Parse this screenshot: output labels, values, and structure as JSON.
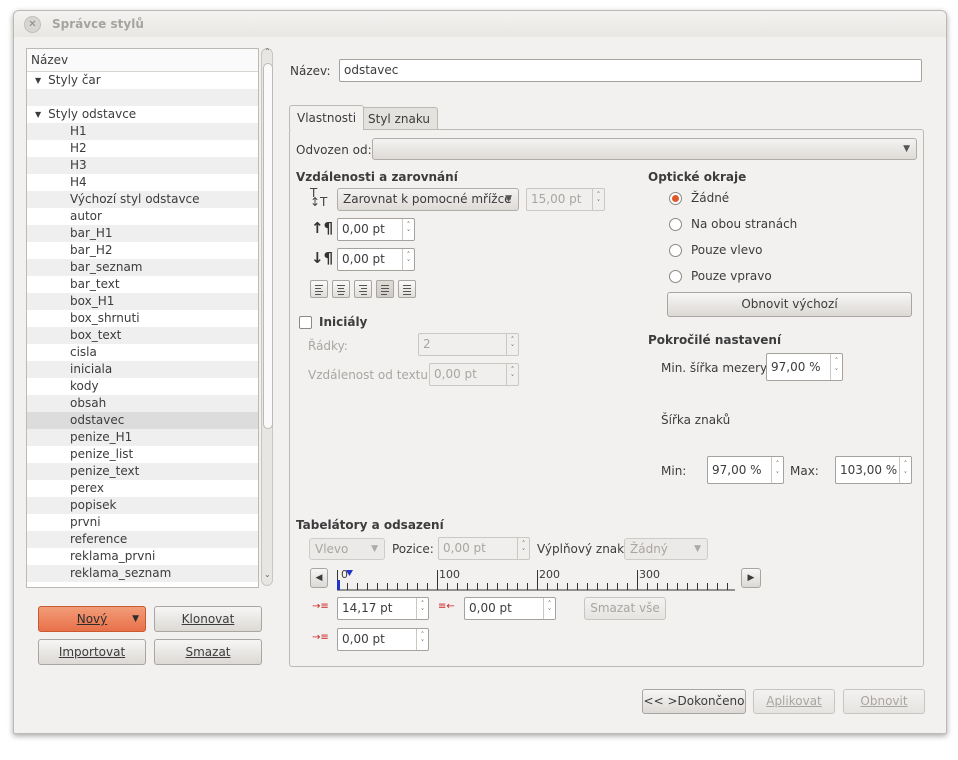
{
  "window": {
    "title": "Správce stylů"
  },
  "style_list": {
    "header": "Název",
    "groups": [
      {
        "label": "Styly čar",
        "items": []
      },
      {
        "label": "Styly odstavce",
        "items": [
          "H1",
          "H2",
          "H3",
          "H4",
          "Výchozí styl odstavce",
          "autor",
          "bar_H1",
          "bar_H2",
          "bar_seznam",
          "bar_text",
          "box_H1",
          "box_shrnuti",
          "box_text",
          "cisla",
          "iniciala",
          "kody",
          "obsah",
          "odstavec",
          "penize_H1",
          "penize_list",
          "penize_text",
          "perex",
          "popisek",
          "prvni",
          "reference",
          "reklama_prvni",
          "reklama_seznam"
        ]
      }
    ],
    "selected": "odstavec"
  },
  "left_buttons": {
    "new": "Nový",
    "clone": "Klonovat",
    "import": "Importovat",
    "delete": "Smazat"
  },
  "name_field": {
    "label": "Název:",
    "value": "odstavec"
  },
  "tabs": [
    "Vlastnosti",
    "Styl znaku"
  ],
  "active_tab": "Vlastnosti",
  "based_on": {
    "label": "Odvozen od:",
    "value": ""
  },
  "spacing": {
    "title": "Vzdálenosti a zarovnání",
    "line_spacing_mode": "Zarovnat k pomocné mřížce",
    "line_spacing_value": "15,00 pt",
    "space_above": "0,00 pt",
    "space_below": "0,00 pt"
  },
  "initials": {
    "label": "Iniciály",
    "lines_label": "Řádky:",
    "lines_value": "2",
    "distance_label": "Vzdálenost od textu:",
    "distance_value": "0,00 pt"
  },
  "optical_margins": {
    "title": "Optické okraje",
    "options": [
      "Žádné",
      "Na obou stranách",
      "Pouze vlevo",
      "Pouze vpravo"
    ],
    "selected": "Žádné",
    "reset_button": "Obnovit výchozí"
  },
  "advanced": {
    "title": "Pokročilé nastavení",
    "min_space_label": "Min. šířka mezery:",
    "min_space_value": "97,00 %",
    "glyph_width_label": "Šířka znaků",
    "min_label": "Min:",
    "min_value": "97,00 %",
    "max_label": "Max:",
    "max_value": "103,00 %"
  },
  "tabs_indents": {
    "title": "Tabelátory a odsazení",
    "tab_type": "Vlevo",
    "position_label": "Pozice:",
    "position_value": "0,00 pt",
    "fill_label": "Výplňový znak:",
    "fill_value": "Žádný",
    "ruler_labels": [
      "0",
      "100",
      "200",
      "300"
    ],
    "first_line_indent": "14,17 pt",
    "right_indent": "0,00 pt",
    "left_indent": "0,00 pt",
    "clear_all": "Smazat vše"
  },
  "bottom_buttons": {
    "done": "<< >Dokončeno",
    "apply": "Aplikovat",
    "reset": "Obnovit"
  }
}
